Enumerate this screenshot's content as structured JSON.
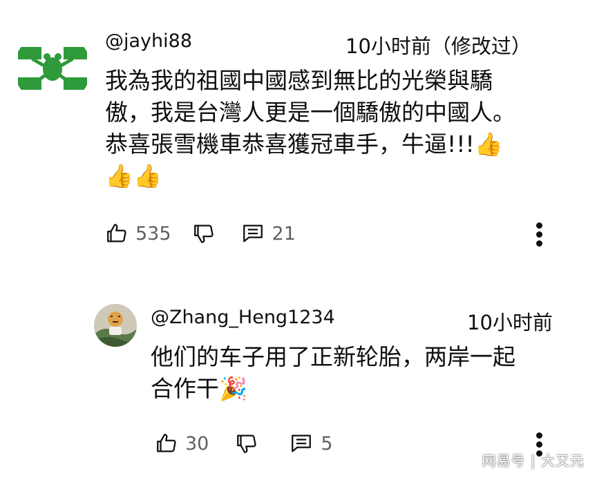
{
  "comments": [
    {
      "handle": "@jayhi88",
      "time": "10小时前（修改过）",
      "text_lines": [
        "我為我的祖國中國感到無比的光榮與驕",
        "傲，我是台灣人更是一個驕傲的中國人。",
        "恭喜張雪機車恭喜獲冠車手，牛逼!!!👍",
        "👍👍"
      ],
      "likes": "535",
      "replies": "21"
    },
    {
      "handle": "@Zhang_Heng1234",
      "time": "10小时前",
      "text_lines": [
        "他们的车子用了正新轮胎，两岸一起",
        "合作干🎉"
      ],
      "likes": "30",
      "replies": "5"
    }
  ],
  "watermark": "网易号 | 大又元",
  "icons": {
    "like": "thumbs-up-icon",
    "dislike": "thumbs-down-icon",
    "reply": "comment-icon",
    "more": "more-vertical-icon"
  }
}
